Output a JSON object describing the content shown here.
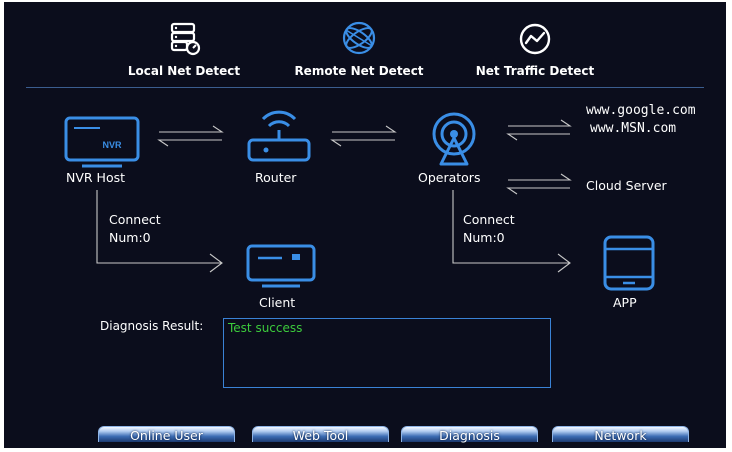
{
  "tabs": [
    {
      "label": "Local Net Detect",
      "icon": "local-net-detect-icon"
    },
    {
      "label": "Remote Net Detect",
      "icon": "globe-icon"
    },
    {
      "label": "Net Traffic Detect",
      "icon": "traffic-chart-icon"
    }
  ],
  "nodes": {
    "nvr_host": "NVR Host",
    "nvr_badge": "NVR",
    "router": "Router",
    "operators": "Operators",
    "client": "Client",
    "app": "APP",
    "google": "www.google.com",
    "msn": "www.MSN.com",
    "cloud": "Cloud Server"
  },
  "connections": {
    "left_label": "Connect",
    "left_num": "Num:0",
    "right_label": "Connect",
    "right_num": "Num:0"
  },
  "diagnosis": {
    "label": "Diagnosis Result:",
    "result": "Test success"
  },
  "buttons": {
    "online_user": "Online User",
    "web_tool": "Web Tool",
    "diagnosis": "Diagnosis",
    "network": "Network"
  },
  "colors": {
    "background": "#0b0d1c",
    "icon_blue": "#3a8ee6",
    "success_green": "#3ccb3c"
  }
}
